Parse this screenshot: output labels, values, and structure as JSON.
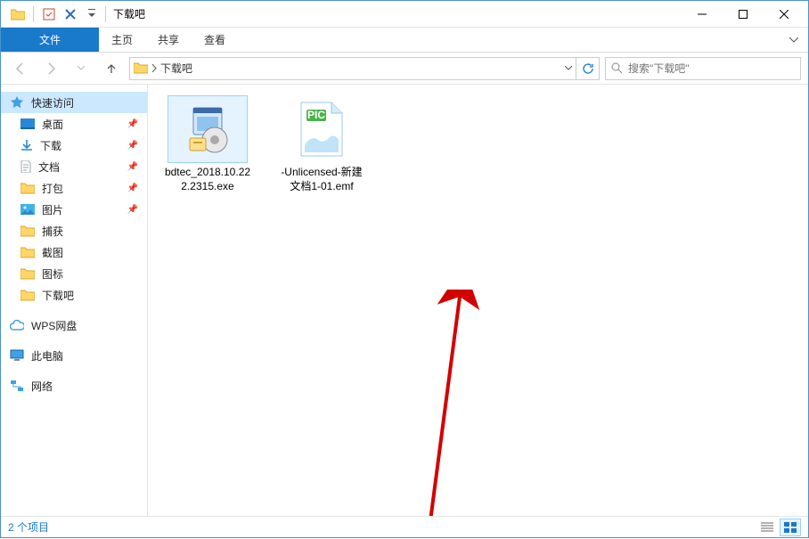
{
  "window": {
    "title": "下载吧"
  },
  "ribbon": {
    "file": "文件",
    "tabs": [
      "主页",
      "共享",
      "查看"
    ]
  },
  "address": {
    "crumb": "下载吧"
  },
  "search": {
    "placeholder": "搜索\"下载吧\""
  },
  "sidebar": {
    "quick_access": "快速访问",
    "pinned": [
      {
        "label": "桌面"
      },
      {
        "label": "下载"
      },
      {
        "label": "文档"
      },
      {
        "label": "打包"
      },
      {
        "label": "图片"
      }
    ],
    "frequent": [
      {
        "label": "捕获"
      },
      {
        "label": "截图"
      },
      {
        "label": "图标"
      },
      {
        "label": "下载吧"
      }
    ],
    "wps": "WPS网盘",
    "thispc": "此电脑",
    "network": "网络"
  },
  "files": [
    {
      "name": "bdtec_2018.10.222.2315.exe"
    },
    {
      "name": "-Unlicensed-新建文档1-01.emf"
    }
  ],
  "status": {
    "count": "2 个项目"
  }
}
